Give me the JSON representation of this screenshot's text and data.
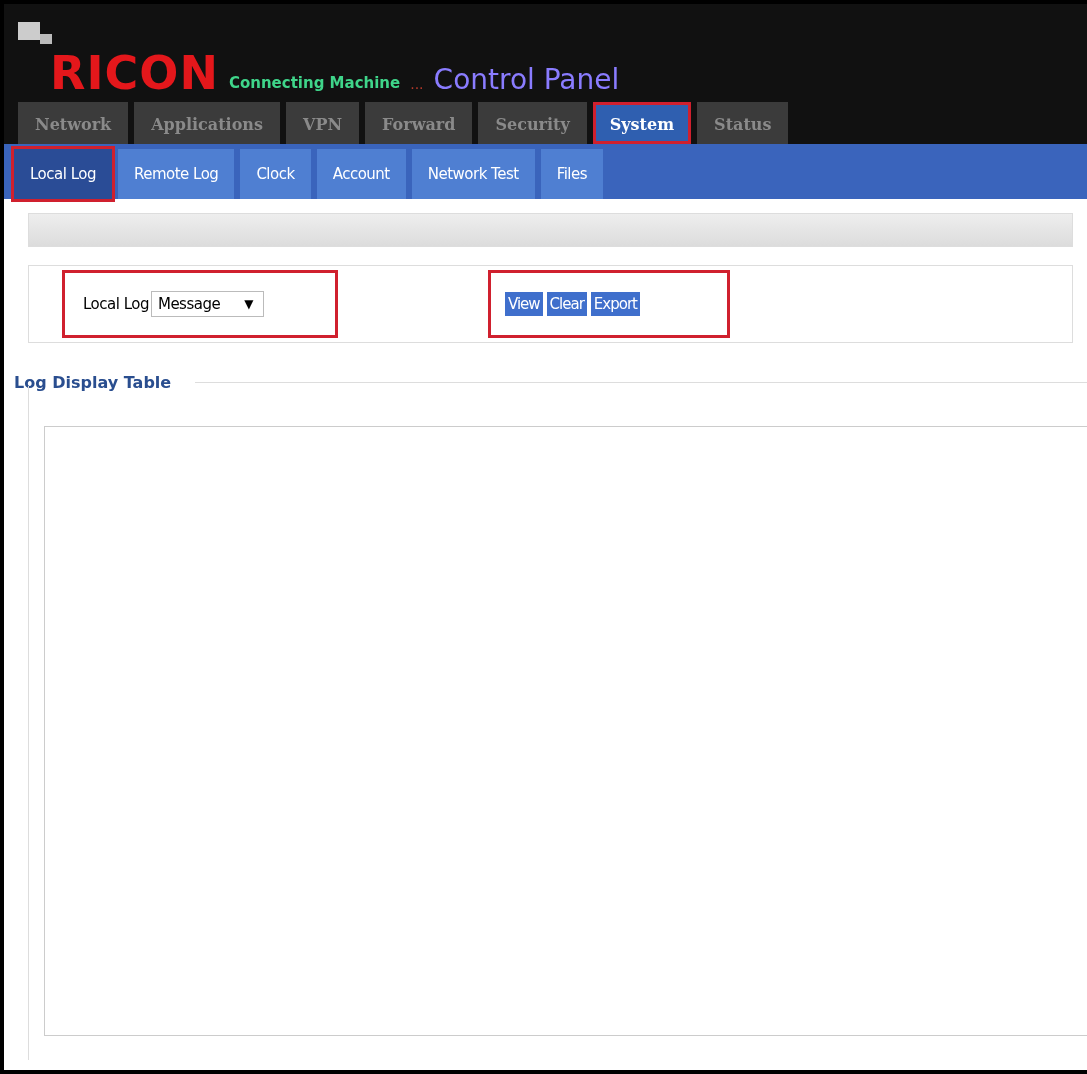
{
  "header": {
    "brand": "RICON",
    "tagline": "Connecting Machine",
    "ellipsis": "...",
    "title": "Control Panel"
  },
  "tabs": [
    {
      "label": "Network",
      "selected": false,
      "highlighted": false
    },
    {
      "label": "Applications",
      "selected": false,
      "highlighted": false
    },
    {
      "label": "VPN",
      "selected": false,
      "highlighted": false
    },
    {
      "label": "Forward",
      "selected": false,
      "highlighted": false
    },
    {
      "label": "Security",
      "selected": false,
      "highlighted": false
    },
    {
      "label": "System",
      "selected": true,
      "highlighted": true
    },
    {
      "label": "Status",
      "selected": false,
      "highlighted": false
    }
  ],
  "subtabs": [
    {
      "label": "Local Log",
      "selected": true,
      "highlighted": true
    },
    {
      "label": "Remote Log",
      "selected": false,
      "highlighted": false
    },
    {
      "label": "Clock",
      "selected": false,
      "highlighted": false
    },
    {
      "label": "Account",
      "selected": false,
      "highlighted": false
    },
    {
      "label": "Network Test",
      "selected": false,
      "highlighted": false
    },
    {
      "label": "Files",
      "selected": false,
      "highlighted": false
    }
  ],
  "log_select": {
    "label": "Local Log",
    "value": "Message",
    "arrow": "▼",
    "highlighted": true
  },
  "actions": {
    "buttons": [
      "View",
      "Clear",
      "Export"
    ],
    "highlighted": true
  },
  "log_display": {
    "legend": "Log Display Table"
  }
}
